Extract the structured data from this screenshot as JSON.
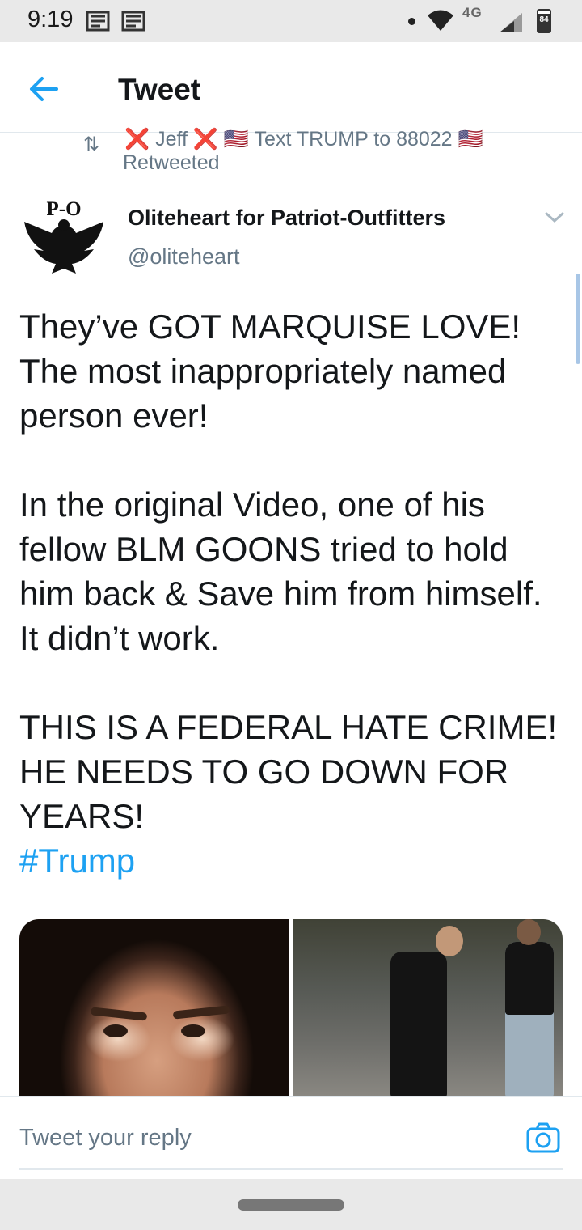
{
  "status_bar": {
    "time": "9:19",
    "network": "4G",
    "battery": "84",
    "battery_level_percent": 84
  },
  "header": {
    "title": "Tweet"
  },
  "retweet": {
    "retweeter_name": "❌ Jeff ❌ 🇺🇸 Text TRUMP to 88022 🇺🇸",
    "label": "Retweeted"
  },
  "tweet": {
    "avatar_text": "P-O",
    "author_name": "Oliteheart for Patriot-Outfitters",
    "author_handle": "@oliteheart",
    "text": "They’ve GOT MARQUISE LOVE! The most inappropriately named person ever!\n\nIn the original Video, one of his fellow BLM GOONS tried to hold him back & Save him from himself. It didn’t work.\n\nTHIS IS A FEDERAL HATE CRIME! HE NEEDS TO GO DOWN FOR YEARS!",
    "hashtag": "#Trump"
  },
  "reply": {
    "placeholder": "Tweet your reply"
  },
  "colors": {
    "accent": "#1da1f2",
    "secondary_text": "#657786",
    "primary_text": "#14171a"
  },
  "icons": {
    "back": "arrow-left-icon",
    "more": "chevron-down-icon",
    "camera": "camera-icon",
    "retweet": "retweet-icon"
  }
}
